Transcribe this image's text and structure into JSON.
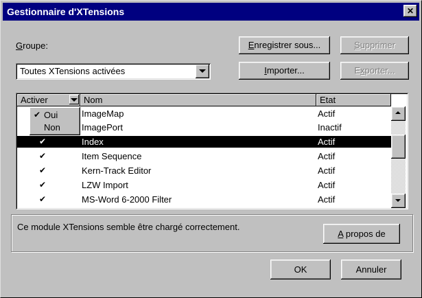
{
  "window": {
    "title": "Gestionnaire d'XTensions",
    "close_glyph": "✕"
  },
  "groupe": {
    "label_mnemonic": "G",
    "label_rest": "roupe:",
    "selected": "Toutes XTensions activées"
  },
  "buttons": {
    "save_as": {
      "mnemonic": "E",
      "rest": "nregistrer sous..."
    },
    "delete": {
      "mnemonic": "S",
      "rest": "upprimer",
      "disabled": true
    },
    "import": {
      "mnemonic": "I",
      "rest": "mporter..."
    },
    "export": {
      "mnemonic": "x",
      "pre": "E",
      "rest": "porter...",
      "disabled": true
    },
    "about": {
      "mnemonic": "A",
      "rest": " propos de"
    },
    "ok": "OK",
    "cancel": "Annuler"
  },
  "list": {
    "columns": {
      "activate": "Activer",
      "name": "Nom",
      "state": "Etat"
    },
    "rows": [
      {
        "check": "",
        "name": "ImageMap",
        "state": "Actif"
      },
      {
        "check": "",
        "name": "ImagePort",
        "state": "Inactif"
      },
      {
        "check": "✔",
        "name": "Index",
        "state": "Actif",
        "selected": true
      },
      {
        "check": "✔",
        "name": "Item Sequence",
        "state": "Actif"
      },
      {
        "check": "✔",
        "name": "Kern-Track Editor",
        "state": "Actif"
      },
      {
        "check": "✔",
        "name": "LZW Import",
        "state": "Actif"
      },
      {
        "check": "✔",
        "name": "MS-Word 6-2000 Filter",
        "state": "Actif"
      }
    ],
    "popup_options": [
      {
        "label": "Oui",
        "checked": true
      },
      {
        "label": "Non",
        "checked": false
      }
    ]
  },
  "status_message": "Ce module XTensions semble être chargé correctement.",
  "colors": {
    "title_bg": "#000080",
    "dialog_bg": "#c0c0c0",
    "selection": "#000000"
  }
}
